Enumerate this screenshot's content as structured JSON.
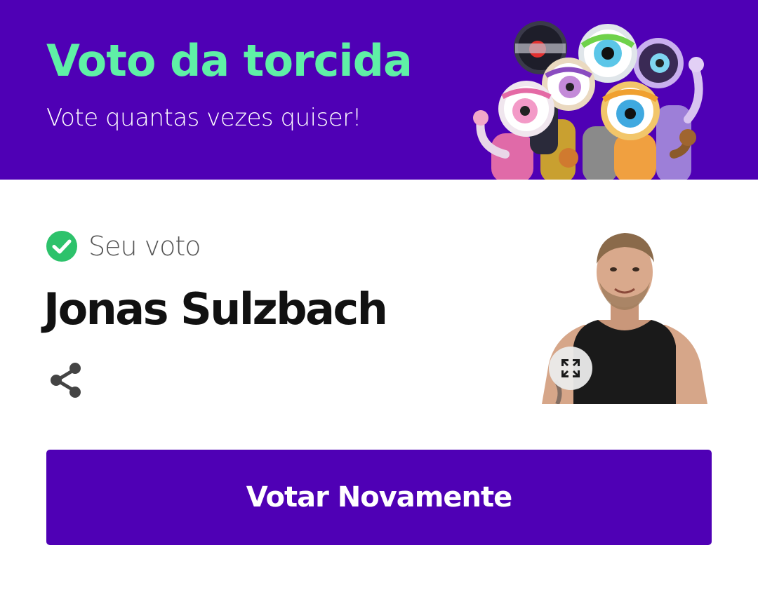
{
  "banner": {
    "title": "Voto da torcida",
    "subtitle": "Vote quantas vezes quiser!",
    "illustration": "big-brother-mascots"
  },
  "vote": {
    "status_label": "Seu voto",
    "status_icon": "check-circle-icon",
    "candidate_name": "Jonas Sulzbach",
    "share_icon": "share-icon",
    "expand_icon": "expand-icon"
  },
  "actions": {
    "vote_again_label": "Votar Novamente"
  },
  "colors": {
    "brand_purple": "#4f00b5",
    "title_green": "#5ff0a6",
    "check_green": "#2dc26b"
  }
}
